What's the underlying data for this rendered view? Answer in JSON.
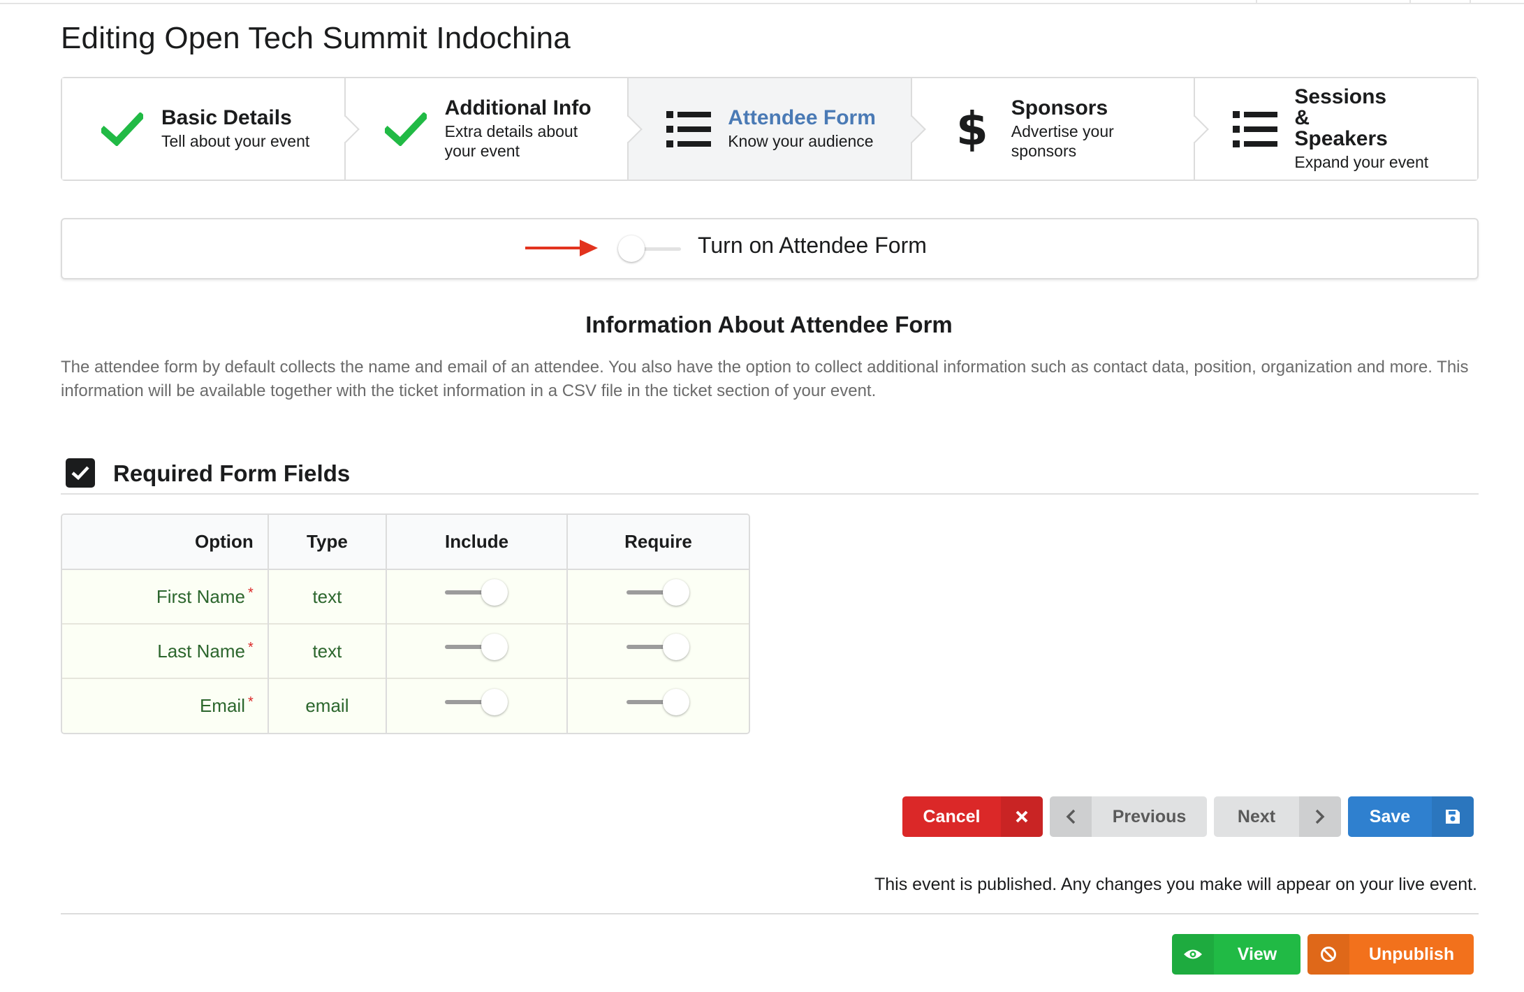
{
  "page": {
    "title": "Editing Open Tech Summit Indochina"
  },
  "steps": [
    {
      "icon": "check-icon",
      "title": "Basic Details",
      "description": "Tell about your event",
      "completed": true
    },
    {
      "icon": "check-icon",
      "title": "Additional Info",
      "description": "Extra details about your event",
      "completed": true
    },
    {
      "icon": "list-icon",
      "title": "Attendee Form",
      "description": "Know your audience",
      "active": true
    },
    {
      "icon": "dollar-icon",
      "title": "Sponsors",
      "description": "Advertise your sponsors"
    },
    {
      "icon": "list-icon",
      "title": "Sessions & Speakers",
      "description": "Expand your event"
    }
  ],
  "attendee_toggle": {
    "label": "Turn on Attendee Form",
    "enabled": false
  },
  "info": {
    "title": "Information About Attendee Form",
    "text": "The attendee form by default collects the name and email of an attendee. You also have the option to collect additional information such as contact data, position, organization and more. This information will be available together with the ticket information in a CSV file in the ticket section of your event."
  },
  "required_fields": {
    "title": "Required Form Fields",
    "checked": true,
    "headers": {
      "option": "Option",
      "type": "Type",
      "include": "Include",
      "require": "Require"
    },
    "rows": [
      {
        "option": "First Name",
        "required_mark": "*",
        "type": "text",
        "include": true,
        "require": true
      },
      {
        "option": "Last Name",
        "required_mark": "*",
        "type": "text",
        "include": true,
        "require": true
      },
      {
        "option": "Email",
        "required_mark": "*",
        "type": "email",
        "include": true,
        "require": true
      }
    ]
  },
  "actions": {
    "cancel": "Cancel",
    "previous": "Previous",
    "next": "Next",
    "save": "Save"
  },
  "publish": {
    "note": "This event is published. Any changes you make will appear on your live event.",
    "view": "View",
    "unpublish": "Unpublish"
  },
  "colors": {
    "cancel": "#db2828",
    "save": "#2f80cf",
    "view": "#21ba45",
    "unpublish": "#f2711c",
    "check": "#21ba45",
    "active_step": "#4a7ab5",
    "arrow": "#e2331e"
  }
}
